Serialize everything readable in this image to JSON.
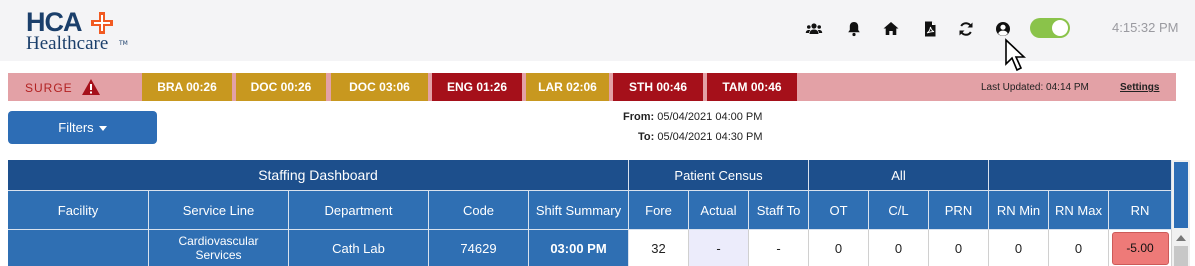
{
  "brand": {
    "name": "HCA",
    "sub": "Healthcare",
    "tm": "TM"
  },
  "header": {
    "icons": [
      "people-icon",
      "bell-icon",
      "home-icon",
      "pdf-icon",
      "refresh-icon",
      "user-icon"
    ],
    "toggle_on": true,
    "time": "4:15:32 PM"
  },
  "surge": {
    "label": "SURGE",
    "chips": [
      {
        "label": "BRA 00:26",
        "color": "#c8981f"
      },
      {
        "label": "DOC 00:26",
        "color": "#c8981f"
      },
      {
        "label": "DOC 03:06",
        "color": "#c8981f"
      },
      {
        "label": "ENG 01:26",
        "color": "#a5101a"
      },
      {
        "label": "LAR 02:06",
        "color": "#c8981f"
      },
      {
        "label": "STH 00:46",
        "color": "#a5101a"
      },
      {
        "label": "TAM 00:46",
        "color": "#a5101a"
      }
    ],
    "last_updated": "Last Updated: 04:14 PM",
    "settings": "Settings"
  },
  "filters": {
    "label": "Filters"
  },
  "range": {
    "from_label": "From:",
    "from": "05/04/2021 04:00 PM",
    "to_label": "To:",
    "to": "05/04/2021 04:30 PM"
  },
  "table": {
    "groups": [
      "Staffing Dashboard",
      "Patient Census",
      "All",
      ""
    ],
    "columns": [
      "Facility",
      "Service Line",
      "Department",
      "Code",
      "Shift Summary",
      "Fore",
      "Actual",
      "Staff To",
      "OT",
      "C/L",
      "PRN",
      "RN Min",
      "RN Max",
      "RN"
    ],
    "rows": [
      {
        "facility": "",
        "service_line": "Cardiovascular Services",
        "department": "Cath Lab",
        "code": "74629",
        "shift_summary": "03:00 PM",
        "fore": "32",
        "actual": "-",
        "staff_to": "-",
        "ot": "0",
        "cl": "0",
        "prn": "0",
        "rn_min": "0",
        "rn_max": "0",
        "rn": "-5.00"
      }
    ]
  },
  "colors": {
    "header_dark": "#1d4f8c",
    "header_mid": "#2f6fb3",
    "rn_negative": "#ee7a78",
    "actual_bg": "#ececfb"
  }
}
